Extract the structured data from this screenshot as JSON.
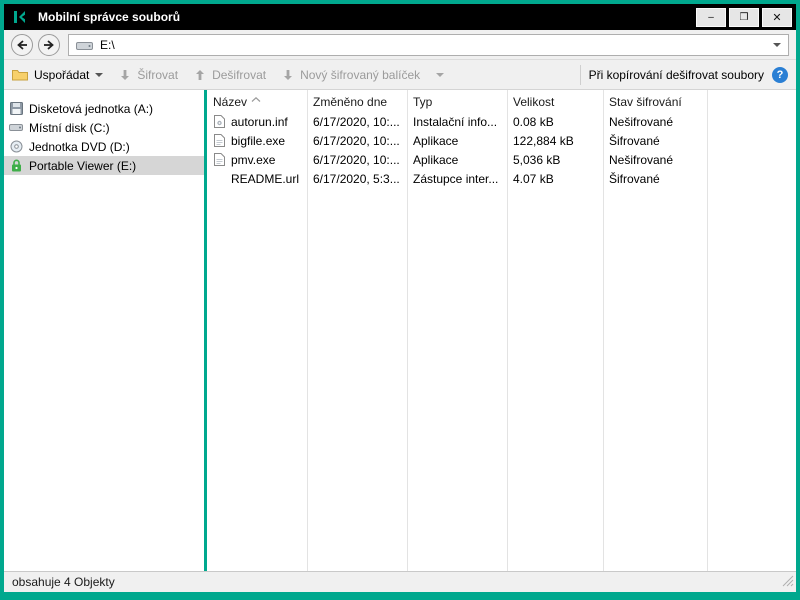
{
  "window": {
    "title": "Mobilní správce souborů",
    "controls": {
      "minimize": "–",
      "maximize": "❒",
      "close": "✕"
    }
  },
  "navbar": {
    "address": "E:\\"
  },
  "toolbar": {
    "organize": "Uspořádat",
    "encrypt": "Šifrovat",
    "decrypt": "Dešifrovat",
    "new_package": "Nový šifrovaný balíček",
    "decrypt_on_copy": "Při kopírování dešifrovat soubory",
    "help": "?"
  },
  "sidebar": {
    "items": [
      {
        "label": "Disketová jednotka (A:)",
        "icon": "floppy-drive-icon",
        "selected": false
      },
      {
        "label": "Místní disk (C:)",
        "icon": "hard-disk-icon",
        "selected": false
      },
      {
        "label": "Jednotka DVD (D:)",
        "icon": "dvd-drive-icon",
        "selected": false
      },
      {
        "label": "Portable Viewer (E:)",
        "icon": "lock-icon",
        "selected": true
      }
    ]
  },
  "filelist": {
    "columns": [
      "Název",
      "Změněno dne",
      "Typ",
      "Velikost",
      "Stav šifrování"
    ],
    "rows": [
      {
        "icon": "inf-file-icon",
        "name": "autorun.inf",
        "modified": "6/17/2020, 10:...",
        "type": "Instalační info...",
        "size": "0.08 kB",
        "status": "Nešifrované"
      },
      {
        "icon": "exe-file-icon",
        "name": "bigfile.exe",
        "modified": "6/17/2020, 10:...",
        "type": "Aplikace",
        "size": "122,884 kB",
        "status": "Šifrované"
      },
      {
        "icon": "exe-file-icon",
        "name": "pmv.exe",
        "modified": "6/17/2020, 10:...",
        "type": "Aplikace",
        "size": "5,036 kB",
        "status": "Nešifrované"
      },
      {
        "icon": "none",
        "name": "README.url",
        "modified": "6/17/2020, 5:3...",
        "type": "Zástupce inter...",
        "size": "4.07 kB",
        "status": "Šifrované"
      }
    ]
  },
  "statusbar": {
    "text": "obsahuje 4 Objekty"
  },
  "colors": {
    "accent": "#00a88e",
    "titlebar": "#000000",
    "selection": "#d6d6d6",
    "info_blue": "#2a7fd4",
    "lock_green": "#3fae49"
  }
}
